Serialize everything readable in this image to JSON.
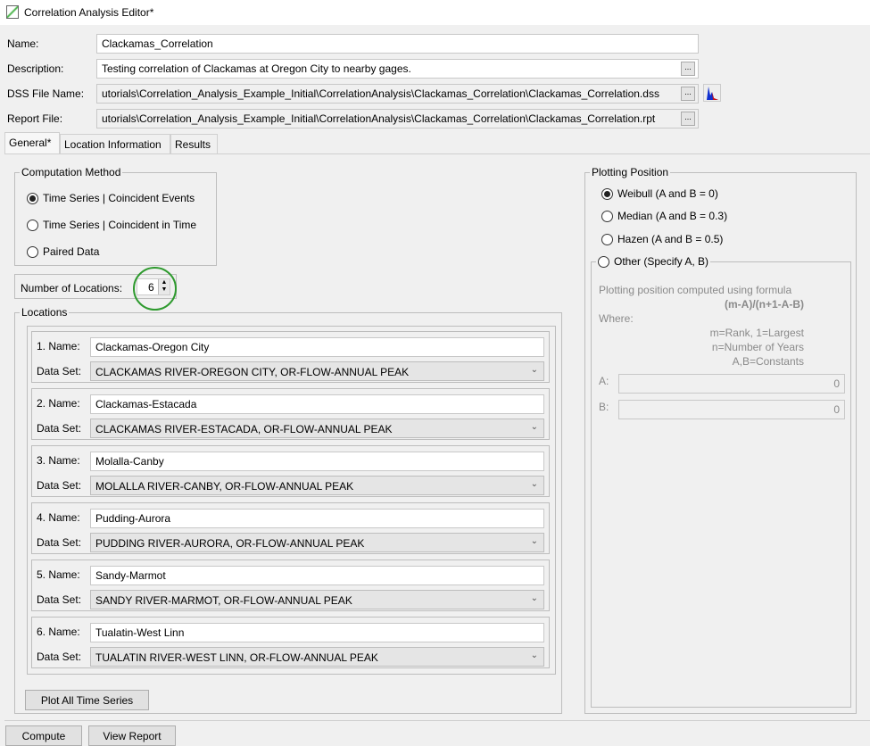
{
  "window": {
    "title": "Correlation Analysis Editor*"
  },
  "form": {
    "name_label": "Name:",
    "name_value": "Clackamas_Correlation",
    "description_label": "Description:",
    "description_value": "Testing correlation of Clackamas at Oregon City to nearby gages.",
    "dss_label": "DSS File Name:",
    "dss_value": "utorials\\Correlation_Analysis_Example_Initial\\CorrelationAnalysis\\Clackamas_Correlation\\Clackamas_Correlation.dss",
    "report_label": "Report File:",
    "report_value": "utorials\\Correlation_Analysis_Example_Initial\\CorrelationAnalysis\\Clackamas_Correlation\\Clackamas_Correlation.rpt",
    "browse_label": "..."
  },
  "tabs": [
    {
      "label": "General*",
      "active": true
    },
    {
      "label": "Location Information"
    },
    {
      "label": "Results"
    }
  ],
  "computation": {
    "title": "Computation Method",
    "options": [
      "Time Series | Coincident Events",
      "Time Series | Coincident in Time",
      "Paired Data"
    ],
    "selected": 0
  },
  "num_locations": {
    "label": "Number of Locations:",
    "value": "6"
  },
  "locations": {
    "title": "Locations",
    "dataset_label": "Data Set:",
    "items": [
      {
        "label": "1. Name:",
        "name": "Clackamas-Oregon City",
        "dataset": "CLACKAMAS RIVER-OREGON CITY, OR-FLOW-ANNUAL PEAK"
      },
      {
        "label": "2. Name:",
        "name": "Clackamas-Estacada",
        "dataset": "CLACKAMAS RIVER-ESTACADA, OR-FLOW-ANNUAL PEAK"
      },
      {
        "label": "3. Name:",
        "name": "Molalla-Canby",
        "dataset": "MOLALLA RIVER-CANBY, OR-FLOW-ANNUAL PEAK"
      },
      {
        "label": "4. Name:",
        "name": "Pudding-Aurora",
        "dataset": "PUDDING RIVER-AURORA, OR-FLOW-ANNUAL PEAK"
      },
      {
        "label": "5. Name:",
        "name": "Sandy-Marmot",
        "dataset": "SANDY RIVER-MARMOT, OR-FLOW-ANNUAL PEAK"
      },
      {
        "label": "6. Name:",
        "name": "Tualatin-West Linn",
        "dataset": "TUALATIN RIVER-WEST LINN, OR-FLOW-ANNUAL PEAK"
      }
    ],
    "plot_button": "Plot All Time Series"
  },
  "plotting": {
    "title": "Plotting Position",
    "options": [
      "Weibull (A and B = 0)",
      "Median (A and B = 0.3)",
      "Hazen (A and B = 0.5)"
    ],
    "selected": 0,
    "other_label": "Other (Specify A, B)",
    "formula_intro": "Plotting position computed using formula",
    "formula": "(m-A)/(n+1-A-B)",
    "where": "Where:",
    "defs": [
      "m=Rank, 1=Largest",
      "n=Number of Years",
      "A,B=Constants"
    ],
    "a_label": "A:",
    "a_value": "0",
    "b_label": "B:",
    "b_value": "0"
  },
  "buttons": {
    "compute": "Compute",
    "view_report": "View Report"
  },
  "colors": {
    "highlight_circle": "#2e9a2e"
  }
}
